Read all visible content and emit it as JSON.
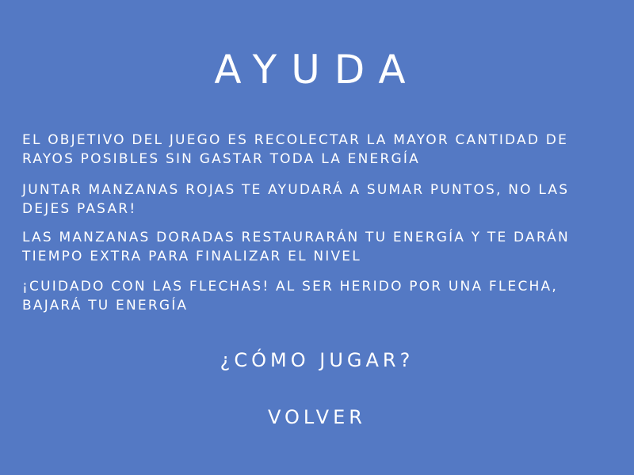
{
  "title": "Ayuda",
  "paragraphs": [
    "El objetivo del juego es recolectar la mayor cantidad de rayos posibles sin gastar toda la energía",
    "Juntar manzanas rojas te ayudará a sumar puntos, no las dejes pasar!",
    "Las manzanas doradas restaurarán tu energía y te darán tiempo extra para finalizar el nivel",
    "¡Cuidado con las flechas! Al ser herido por una flecha, bajará tu energía"
  ],
  "menu": {
    "how_to_play": "¿Cómo jugar?",
    "back": "Volver"
  },
  "colors": {
    "background": "#5479c4",
    "text": "#ffffff"
  }
}
